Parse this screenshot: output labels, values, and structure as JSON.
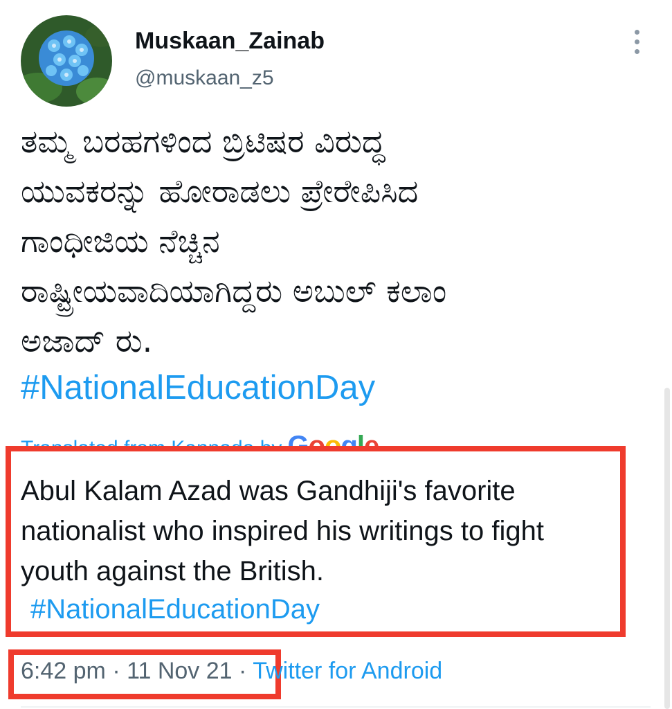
{
  "user": {
    "display_name": "Muskaan_Zainab",
    "handle": "@muskaan_z5",
    "avatar_icon": "hydrangea-flower-avatar"
  },
  "tweet": {
    "original_lines": [
      "ತಮ್ಮ ಬರಹಗಳಿಂದ ಬ್ರಿಟಿಷರ ವಿರುದ್ಧ",
      "ಯುವಕರನ್ನು ಹೋರಾಡಲು ಪ್ರೇರೇಪಿಸಿದ",
      "ಗಾಂಧೀಜಿಯ ನೆಚ್ಚಿನ",
      "ರಾಷ್ಟ್ರೀಯವಾದಿಯಾಗಿದ್ದರು ಅಬುಲ್ ಕಲಾಂ",
      "ಅಜಾದ್ ರು."
    ],
    "original_hashtag": "#NationalEducationDay",
    "translated_label": "Translated from Kannada by",
    "translator_logo": "Google",
    "translation_lines": [
      "Abul Kalam Azad was Gandhiji's favorite",
      "nationalist who inspired his writings to fight",
      "youth against the British."
    ],
    "translation_hashtag": "#NationalEducationDay"
  },
  "meta": {
    "time": "6:42 pm",
    "separator1": "·",
    "date": "11 Nov 21",
    "separator2": "·",
    "source": "Twitter for Android"
  },
  "colors": {
    "link": "#1d9bf0",
    "highlight_border": "#ef3b2d",
    "secondary_text": "#536471",
    "primary_text": "#0f1419"
  },
  "icons": {
    "more": "more-vertical-icon"
  }
}
